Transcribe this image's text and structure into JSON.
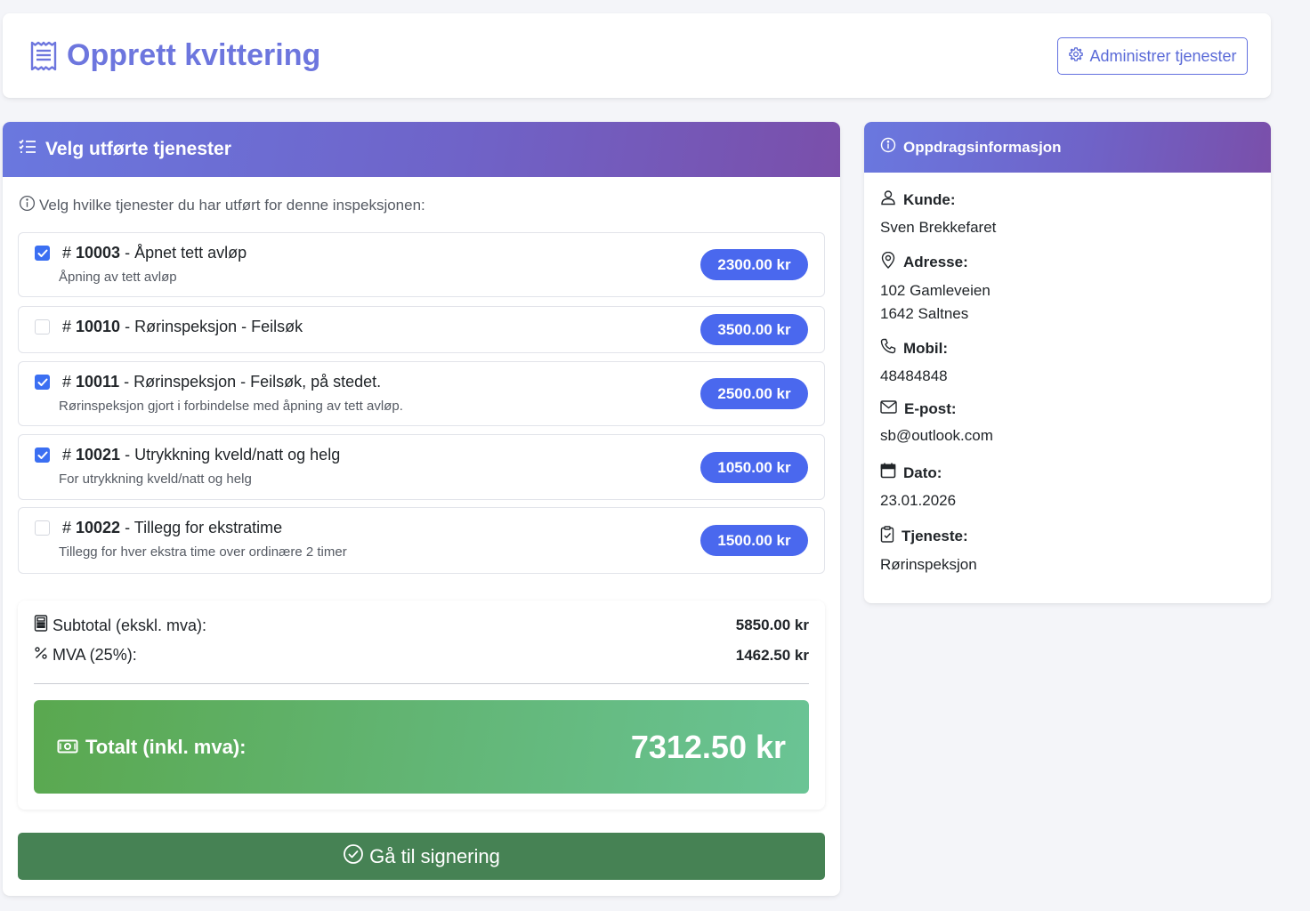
{
  "header": {
    "title": "Opprett kvittering",
    "admin_button": "Administrer tjenester"
  },
  "services_card": {
    "title": "Velg utførte tjenester",
    "intro": "Velg hvilke tjenester du har utført for denne inspeksjonen:",
    "items": [
      {
        "number": "10003",
        "name": "Åpnet tett avløp",
        "description": "Åpning av tett avløp",
        "price": "2300.00 kr",
        "checked": true
      },
      {
        "number": "10010",
        "name": "Rørinspeksjon - Feilsøk",
        "description": "",
        "price": "3500.00 kr",
        "checked": false
      },
      {
        "number": "10011",
        "name": "Rørinspeksjon - Feilsøk, på stedet.",
        "description": "Rørinspeksjon gjort i forbindelse med åpning av tett avløp.",
        "price": "2500.00 kr",
        "checked": true
      },
      {
        "number": "10021",
        "name": "Utrykkning kveld/natt og helg",
        "description": "For utrykkning kveld/natt og helg",
        "price": "1050.00 kr",
        "checked": true
      },
      {
        "number": "10022",
        "name": "Tillegg for ekstratime",
        "description": "Tillegg for hver ekstra time over ordinære 2 timer",
        "price": "1500.00 kr",
        "checked": false
      }
    ]
  },
  "totals": {
    "subtotal_label": "Subtotal (ekskl. mva):",
    "subtotal_value": "5850.00 kr",
    "vat_label": "MVA (25%):",
    "vat_value": "1462.50 kr",
    "total_label": "Totalt (inkl. mva):",
    "total_value": "7312.50 kr"
  },
  "sign_button": "Gå til signering",
  "info_card": {
    "title": "Oppdragsinformasjon",
    "customer_label": "Kunde:",
    "customer": "Sven Brekkefaret",
    "address_label": "Adresse:",
    "address_line1": "102 Gamleveien",
    "address_line2": "1642 Saltnes",
    "mobile_label": "Mobil:",
    "mobile": "48484848",
    "email_label": "E-post:",
    "email": "sb@outlook.com",
    "date_label": "Dato:",
    "date": "23.01.2026",
    "service_label": "Tjeneste:",
    "service": "Rørinspeksjon"
  },
  "colors": {
    "accent": "#6d76de",
    "price_badge": "#4a68ee",
    "checkbox": "#3b6ff2",
    "sign_button": "#468254",
    "total_gradient_start": "#5aa84f",
    "total_gradient_end": "#6ac495"
  },
  "icons": {
    "header": "receipt-icon",
    "admin": "gear-icon",
    "services": "list-check-icon",
    "intro": "info-circle-icon",
    "subtotal": "calculator-icon",
    "vat": "percent-icon",
    "total": "cash-icon",
    "sign": "check-circle-icon",
    "info": "info-circle-icon",
    "customer": "person-icon",
    "address": "geo-pin-icon",
    "mobile": "telephone-icon",
    "email": "envelope-icon",
    "date": "calendar-icon",
    "service": "clipboard-check-icon"
  }
}
